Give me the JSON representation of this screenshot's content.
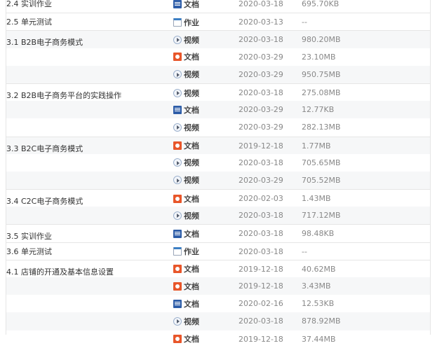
{
  "table": {
    "rows": [
      {
        "title": "2.4 实训作业",
        "type_icon": "word-icon",
        "type": "文档",
        "date": "2020-03-18",
        "size": "695.70KB"
      },
      {
        "title": "2.5 单元测试",
        "type_icon": "homework-icon",
        "type": "作业",
        "date": "2020-03-13",
        "size": "--"
      },
      {
        "title": "3.1 B2B电子商务模式",
        "type_icon": "video-icon",
        "type": "视频",
        "date": "2020-03-18",
        "size": "980.20MB"
      },
      {
        "title": "",
        "type_icon": "ppt-icon",
        "type": "文档",
        "date": "2020-03-29",
        "size": "23.10MB"
      },
      {
        "title": "",
        "type_icon": "video-icon",
        "type": "视频",
        "date": "2020-03-29",
        "size": "950.75MB"
      },
      {
        "title": "3.2 B2B电子商务平台的实践操作",
        "type_icon": "video-icon",
        "type": "视频",
        "date": "2020-03-18",
        "size": "275.08MB"
      },
      {
        "title": "",
        "type_icon": "word-icon",
        "type": "文档",
        "date": "2020-03-29",
        "size": "12.77KB"
      },
      {
        "title": "",
        "type_icon": "video-icon",
        "type": "视频",
        "date": "2020-03-29",
        "size": "282.13MB"
      },
      {
        "title": "3.3 B2C电子商务模式",
        "type_icon": "ppt-icon",
        "type": "文档",
        "date": "2019-12-18",
        "size": "1.77MB"
      },
      {
        "title": "",
        "type_icon": "video-icon",
        "type": "视频",
        "date": "2020-03-18",
        "size": "705.65MB"
      },
      {
        "title": "",
        "type_icon": "video-icon",
        "type": "视频",
        "date": "2020-03-29",
        "size": "705.52MB"
      },
      {
        "title": "3.4 C2C电子商务模式",
        "type_icon": "ppt-icon",
        "type": "文档",
        "date": "2020-02-03",
        "size": "1.43MB"
      },
      {
        "title": "",
        "type_icon": "video-icon",
        "type": "视频",
        "date": "2020-03-18",
        "size": "717.12MB"
      },
      {
        "title": "3.5 实训作业",
        "type_icon": "word-icon",
        "type": "文档",
        "date": "2020-03-18",
        "size": "98.48KB"
      },
      {
        "title": "3.6 单元测试",
        "type_icon": "homework-icon",
        "type": "作业",
        "date": "2020-03-18",
        "size": "--"
      },
      {
        "title": "4.1 店铺的开通及基本信息设置",
        "type_icon": "ppt-icon",
        "type": "文档",
        "date": "2019-12-18",
        "size": "40.62MB"
      },
      {
        "title": "",
        "type_icon": "ppt-icon",
        "type": "文档",
        "date": "2019-12-18",
        "size": "3.43MB"
      },
      {
        "title": "",
        "type_icon": "word-icon",
        "type": "文档",
        "date": "2020-02-16",
        "size": "12.53KB"
      },
      {
        "title": "",
        "type_icon": "video-icon",
        "type": "视频",
        "date": "2020-03-18",
        "size": "878.92MB"
      },
      {
        "title": "",
        "type_icon": "ppt-icon",
        "type": "文档",
        "date": "2019-12-18",
        "size": "37.44MB"
      }
    ]
  }
}
